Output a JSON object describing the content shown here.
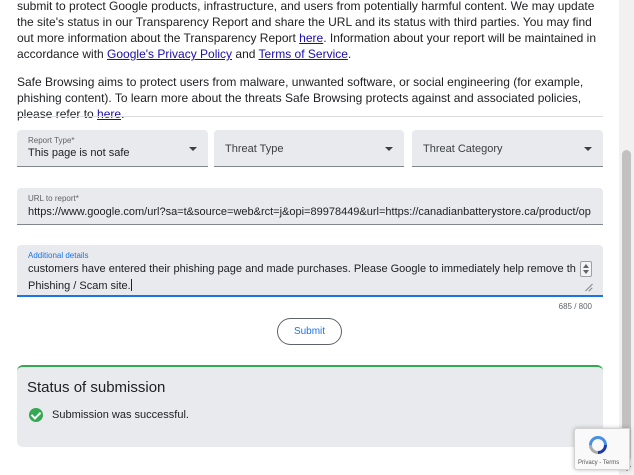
{
  "para1": {
    "text_a": "submit to protect Google products, infrastructure, and users from potentially harmful content. We may update the site's status in our Transparency Report and share the URL and its status with third parties. You may find out more information about the Transparency Report ",
    "link_here": "here",
    "text_b": ". Information about your report will be maintained in accordance with ",
    "link_privacy": "Google's Privacy Policy",
    "text_and": " and ",
    "link_terms": "Terms of Service",
    "text_end": "."
  },
  "para2": {
    "text": "Safe Browsing aims to protect users from malware, unwanted software, or social engineering (for example, phishing content). To learn more about the threats Safe Browsing protects against and associated policies, please refer to ",
    "link_here": "here",
    "text_end": "."
  },
  "form": {
    "report_type": {
      "label": "Report Type*",
      "value": "This page is not safe"
    },
    "threat_type": {
      "placeholder": "Threat Type"
    },
    "threat_category": {
      "placeholder": "Threat Category"
    },
    "url": {
      "label": "URL to report*",
      "value": "https://www.google.com/url?sa=t&source=web&rct=j&opi=89978449&url=https://canadianbatterystore.ca/product/op"
    },
    "details": {
      "label": "Additional details",
      "line1": "customers have entered their phishing page and made purchases. Please Google to immediately help remove this",
      "line2": "Phishing / Scam site."
    },
    "counter": "685 / 800",
    "submit_label": "Submit"
  },
  "status": {
    "title": "Status of submission",
    "message": "Submission was successful."
  },
  "recaptcha": {
    "links": "Privacy - Terms"
  },
  "colors": {
    "link": "#1a0dab",
    "accent": "#1a73e8",
    "success": "#34a853",
    "field_bg": "#e8eaed"
  },
  "icons": [
    "chevron-down-icon",
    "check-circle-icon",
    "recaptcha-icon"
  ]
}
